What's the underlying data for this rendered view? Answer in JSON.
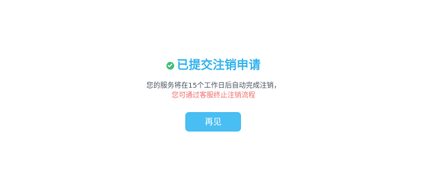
{
  "status": {
    "title": "已提交注销申请",
    "icon": "check-circle-icon",
    "icon_color": "#3dbf74",
    "title_color": "#35b4ee"
  },
  "messages": {
    "primary": "您的服务将在15个工作日后自动完成注销，",
    "secondary": "您可通过客服终止注销流程",
    "secondary_color": "#f16d6d"
  },
  "actions": {
    "goodbye_label": "再见",
    "button_color": "#49bef3"
  }
}
